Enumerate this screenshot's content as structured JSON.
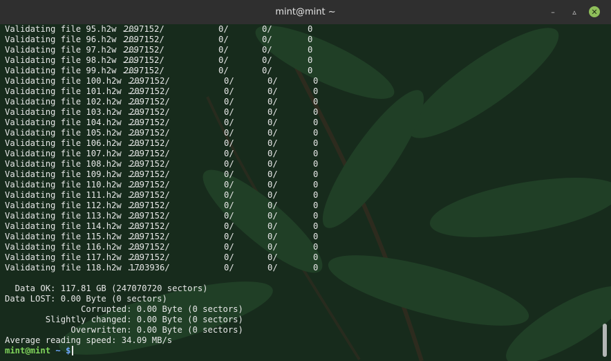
{
  "window": {
    "title": "mint@mint ~"
  },
  "terminal": {
    "validate_rows": [
      {
        "file": "95.h2w",
        "size": "2097152/",
        "a": "0/",
        "b": "0/",
        "c": "0"
      },
      {
        "file": "96.h2w",
        "size": "2097152/",
        "a": "0/",
        "b": "0/",
        "c": "0"
      },
      {
        "file": "97.h2w",
        "size": "2097152/",
        "a": "0/",
        "b": "0/",
        "c": "0"
      },
      {
        "file": "98.h2w",
        "size": "2097152/",
        "a": "0/",
        "b": "0/",
        "c": "0"
      },
      {
        "file": "99.h2w",
        "size": "2097152/",
        "a": "0/",
        "b": "0/",
        "c": "0"
      },
      {
        "file": "100.h2w",
        "size": "2097152/",
        "a": "0/",
        "b": "0/",
        "c": "0"
      },
      {
        "file": "101.h2w",
        "size": "2097152/",
        "a": "0/",
        "b": "0/",
        "c": "0"
      },
      {
        "file": "102.h2w",
        "size": "2097152/",
        "a": "0/",
        "b": "0/",
        "c": "0"
      },
      {
        "file": "103.h2w",
        "size": "2097152/",
        "a": "0/",
        "b": "0/",
        "c": "0"
      },
      {
        "file": "104.h2w",
        "size": "2097152/",
        "a": "0/",
        "b": "0/",
        "c": "0"
      },
      {
        "file": "105.h2w",
        "size": "2097152/",
        "a": "0/",
        "b": "0/",
        "c": "0"
      },
      {
        "file": "106.h2w",
        "size": "2097152/",
        "a": "0/",
        "b": "0/",
        "c": "0"
      },
      {
        "file": "107.h2w",
        "size": "2097152/",
        "a": "0/",
        "b": "0/",
        "c": "0"
      },
      {
        "file": "108.h2w",
        "size": "2097152/",
        "a": "0/",
        "b": "0/",
        "c": "0"
      },
      {
        "file": "109.h2w",
        "size": "2097152/",
        "a": "0/",
        "b": "0/",
        "c": "0"
      },
      {
        "file": "110.h2w",
        "size": "2097152/",
        "a": "0/",
        "b": "0/",
        "c": "0"
      },
      {
        "file": "111.h2w",
        "size": "2097152/",
        "a": "0/",
        "b": "0/",
        "c": "0"
      },
      {
        "file": "112.h2w",
        "size": "2097152/",
        "a": "0/",
        "b": "0/",
        "c": "0"
      },
      {
        "file": "113.h2w",
        "size": "2097152/",
        "a": "0/",
        "b": "0/",
        "c": "0"
      },
      {
        "file": "114.h2w",
        "size": "2097152/",
        "a": "0/",
        "b": "0/",
        "c": "0"
      },
      {
        "file": "115.h2w",
        "size": "2097152/",
        "a": "0/",
        "b": "0/",
        "c": "0"
      },
      {
        "file": "116.h2w",
        "size": "2097152/",
        "a": "0/",
        "b": "0/",
        "c": "0"
      },
      {
        "file": "117.h2w",
        "size": "2097152/",
        "a": "0/",
        "b": "0/",
        "c": "0"
      },
      {
        "file": "118.h2w",
        "size": "1703936/",
        "a": "0/",
        "b": "0/",
        "c": "0"
      }
    ],
    "validate_prefix": "Validating file ",
    "validate_dots": " ...",
    "summary": [
      "  Data OK: 117.81 GB (247070720 sectors)",
      "Data LOST: 0.00 Byte (0 sectors)",
      "               Corrupted: 0.00 Byte (0 sectors)",
      "        Slightly changed: 0.00 Byte (0 sectors)",
      "             Overwritten: 0.00 Byte (0 sectors)",
      "Average reading speed: 34.09 MB/s"
    ],
    "prompt": {
      "user": "mint@mint",
      "path": " ~ $",
      "cursor": ""
    }
  },
  "colors": {
    "titlebar": "#2f2f2f",
    "close_button": "#8fbf5a",
    "prompt_user": "#7fd35a",
    "prompt_path": "#6fa8ff",
    "text": "#e8e8e8"
  },
  "icons": {
    "minimize": "minimize-icon",
    "maximize": "maximize-icon",
    "close": "close-icon"
  }
}
